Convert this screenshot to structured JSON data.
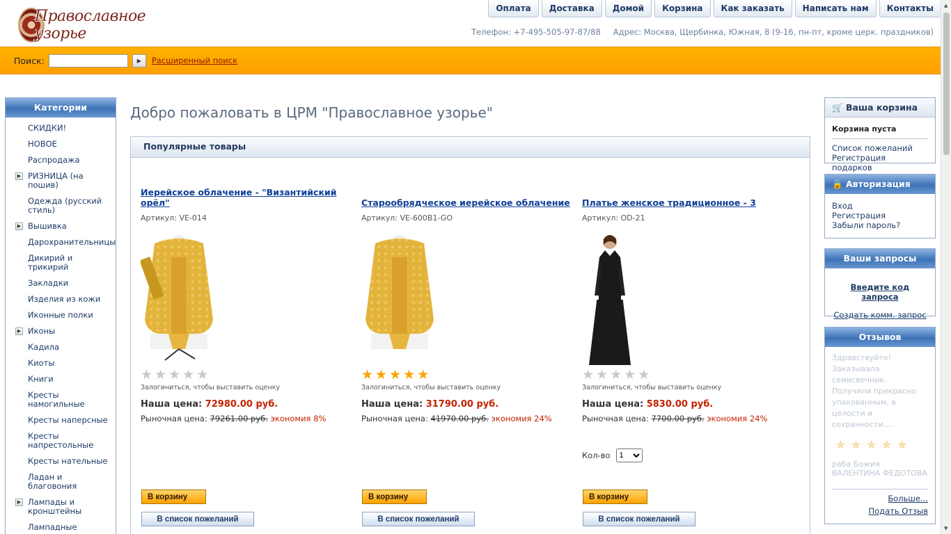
{
  "header": {
    "logo_text": "Православное узорье",
    "nav": [
      "Оплата",
      "Доставка",
      "Домой",
      "Корзина",
      "Как заказать",
      "Написать нам",
      "Контакты"
    ],
    "phone": "Телефон: +7-495-505-97-87/88",
    "address": "Адрес: Москва, Щербинка, Южная, 8 (9-16, пн-пт, кроме церк. праздников)"
  },
  "search": {
    "label": "Поиск:",
    "value": "",
    "go_icon": "arrow-right-icon",
    "advanced": "Расширенный поиск"
  },
  "categories": {
    "title": "Категории",
    "items": [
      {
        "label": "СКИДКИ!",
        "expandable": false
      },
      {
        "label": "НОВОЕ",
        "expandable": false
      },
      {
        "label": "Распродажа",
        "expandable": false
      },
      {
        "label": "РИЗНИЦА (на пошив)",
        "expandable": true
      },
      {
        "label": "Одежда (русский стиль)",
        "expandable": false
      },
      {
        "label": "Вышивка",
        "expandable": true
      },
      {
        "label": "Дарохранительницы",
        "expandable": false
      },
      {
        "label": "Дикирий и трикирий",
        "expandable": false
      },
      {
        "label": "Закладки",
        "expandable": false
      },
      {
        "label": "Изделия из кожи",
        "expandable": false
      },
      {
        "label": "Иконные полки",
        "expandable": false
      },
      {
        "label": "Иконы",
        "expandable": true
      },
      {
        "label": "Кадила",
        "expandable": false
      },
      {
        "label": "Киоты",
        "expandable": false
      },
      {
        "label": "Книги",
        "expandable": false
      },
      {
        "label": "Кресты намогильные",
        "expandable": false
      },
      {
        "label": "Кресты наперсные",
        "expandable": false
      },
      {
        "label": "Кресты напрестольные",
        "expandable": false
      },
      {
        "label": "Кресты нательные",
        "expandable": false
      },
      {
        "label": "Ладан и благовония",
        "expandable": false
      },
      {
        "label": "Лампады и кронштейны",
        "expandable": true
      },
      {
        "label": "Лампадные",
        "expandable": false
      }
    ]
  },
  "main": {
    "title": "Добро пожаловать в ЦРМ \"Православное узорье\"",
    "popular_title": "Популярные товары",
    "products": [
      {
        "name": "Иерейское облачение - \"Византийский орёл\"",
        "sku": "Артикул: VE-014",
        "rating": 0,
        "rate_note": "Залогиниться, чтобы выставить оценку",
        "price_label": "Наша цена:",
        "price": "72980.00 руб.",
        "market_label": "Рыночная цена:",
        "market_price": "79261.00 руб.",
        "economy": "экономия 8%",
        "cart_button": "В корзину",
        "wish_button": "В список пожеланий",
        "image": "gold-vestment-with-stand"
      },
      {
        "name": "Старообрядческое иерейское облачение",
        "sku": "Артикул: VE-600B1-GO",
        "rating": 5,
        "rate_note": "Залогиниться, чтобы выставить оценку",
        "price_label": "Наша цена:",
        "price": "31790.00 руб.",
        "market_label": "Рыночная цена:",
        "market_price": "41970.00 руб.",
        "economy": "экономия 24%",
        "cart_button": "В корзину",
        "wish_button": "В список пожеланий",
        "image": "gold-vestment"
      },
      {
        "name": "Платье женское традиционное - 3",
        "sku": "Артикул: OD-21",
        "rating": 0,
        "rate_note": "Залогиниться, чтобы выставить оценку",
        "price_label": "Наша цена:",
        "price": "5830.00 руб.",
        "market_label": "Рыночная цена:",
        "market_price": "7700.00 руб.",
        "economy": "экономия 24%",
        "qty_label": "Кол-во",
        "qty_value": "1",
        "cart_button": "В корзину",
        "wish_button": "В список пожеланий",
        "image": "black-dress-woman"
      }
    ]
  },
  "right": {
    "cart": {
      "title": "Ваша корзина",
      "icon": "cart-icon",
      "empty": "Корзина пуста",
      "wishlist": "Список пожеланий",
      "registry": "Регистрация подарков"
    },
    "auth": {
      "title": "Авторизация",
      "icon": "lock-icon",
      "login": "Вход",
      "register": "Регистрация",
      "forgot": "Забыли пароль?"
    },
    "requests": {
      "title": "Ваши запросы",
      "enter_code": "Введите код запроса",
      "create": "Создать комм. запрос"
    },
    "reviews": {
      "title": "Отзывов",
      "text": "Здравствуйте! Заказывала семисвечник. Получили прекрасно упакованным, в целости и сохранности....",
      "author": "раба Божия ВАЛЕНТИНА ФЕДОТОВА",
      "more": "Больше...",
      "submit": "Подать Отзыв"
    }
  },
  "colors": {
    "accent": "#ffa000",
    "link": "#0e3f97",
    "price": "#c42200",
    "star_on": "#ffa200"
  }
}
